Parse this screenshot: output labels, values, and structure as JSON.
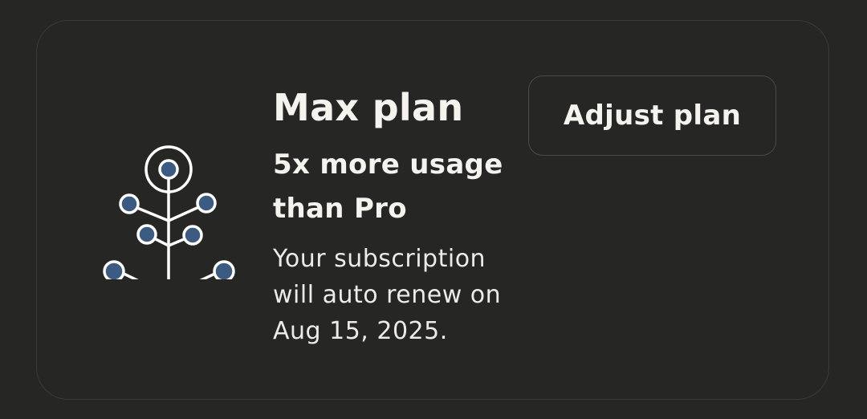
{
  "plan_card": {
    "icon": "growth-tree-icon",
    "title": "Max plan",
    "tagline": "5x more usage than Pro",
    "renewal_text": "Your subscription will auto renew on Aug 15, 2025.",
    "adjust_button_label": "Adjust plan"
  },
  "colors": {
    "background": "#262625",
    "card_border": "#3b3b39",
    "text": "#f4f3ee",
    "icon_stroke": "#ffffff",
    "icon_dot": "#3b5b82"
  }
}
